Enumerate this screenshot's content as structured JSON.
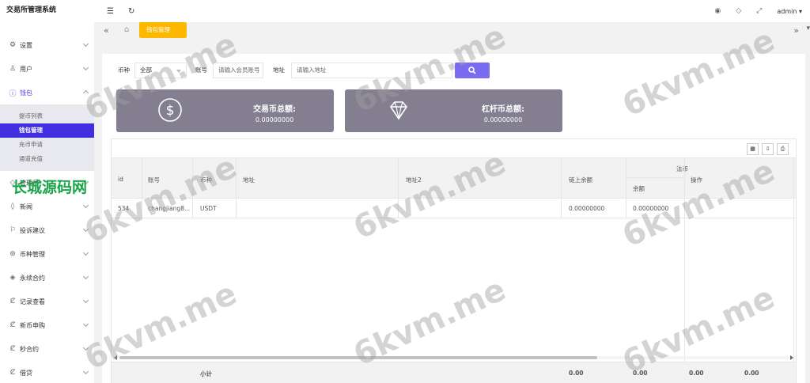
{
  "app": {
    "title": "交易所管理系统"
  },
  "sidebar": {
    "items": [
      {
        "label": "设置",
        "icon": "gear-icon"
      },
      {
        "label": "用户",
        "icon": "user-icon"
      },
      {
        "label": "钱包",
        "icon": "wallet-icon"
      }
    ],
    "wallet_sub": [
      {
        "label": "提币列表"
      },
      {
        "label": "钱包管理"
      },
      {
        "label": "充币申请"
      },
      {
        "label": "通道充值"
      }
    ],
    "items_after": [
      {
        "label": "管理员",
        "icon": "shield-icon"
      },
      {
        "label": "新闻",
        "icon": "tag-icon"
      },
      {
        "label": "投诉建议",
        "icon": "flag-icon"
      },
      {
        "label": "币种管理",
        "icon": "coin-icon"
      },
      {
        "label": "永续合约",
        "icon": "diamond-icon"
      },
      {
        "label": "记录查看",
        "icon": "record-icon"
      },
      {
        "label": "新币申购",
        "icon": "record-icon"
      },
      {
        "label": "秒合约",
        "icon": "record-icon"
      },
      {
        "label": "借贷",
        "icon": "record-icon"
      }
    ]
  },
  "header": {
    "user": "admin"
  },
  "tabs": {
    "active": "钱包管理"
  },
  "filter": {
    "currency_label": "币种",
    "currency_value": "全部",
    "account_label": "账号",
    "account_placeholder": "请输入会员账号",
    "address_label": "地址",
    "address_placeholder": "请输入地址"
  },
  "summary": [
    {
      "title": "交易币总额:",
      "value": "0.00000000",
      "icon": "dollar-icon"
    },
    {
      "title": "杠杆币总额:",
      "value": "0.00000000",
      "icon": "diamond-icon"
    }
  ],
  "table": {
    "columns": {
      "id": "id",
      "account": "账号",
      "currency": "币种",
      "address": "地址",
      "address2": "地址2",
      "chain_balance": "链上余额",
      "legal_group": "法币",
      "balance": "余额",
      "actions": "操作"
    },
    "rows": [
      {
        "id": "534",
        "account": "changjiang8...",
        "currency": "USDT",
        "address": "",
        "address2": "",
        "chain_balance": "0.00000000",
        "balance": "0.00000000"
      }
    ],
    "footer": {
      "label": "小计",
      "v1": "0.00",
      "v2": "0.00",
      "v3": "0.00",
      "v4": "0.00"
    }
  },
  "watermark": {
    "text": "6kvm.me",
    "cn_text": "长城源码网"
  }
}
